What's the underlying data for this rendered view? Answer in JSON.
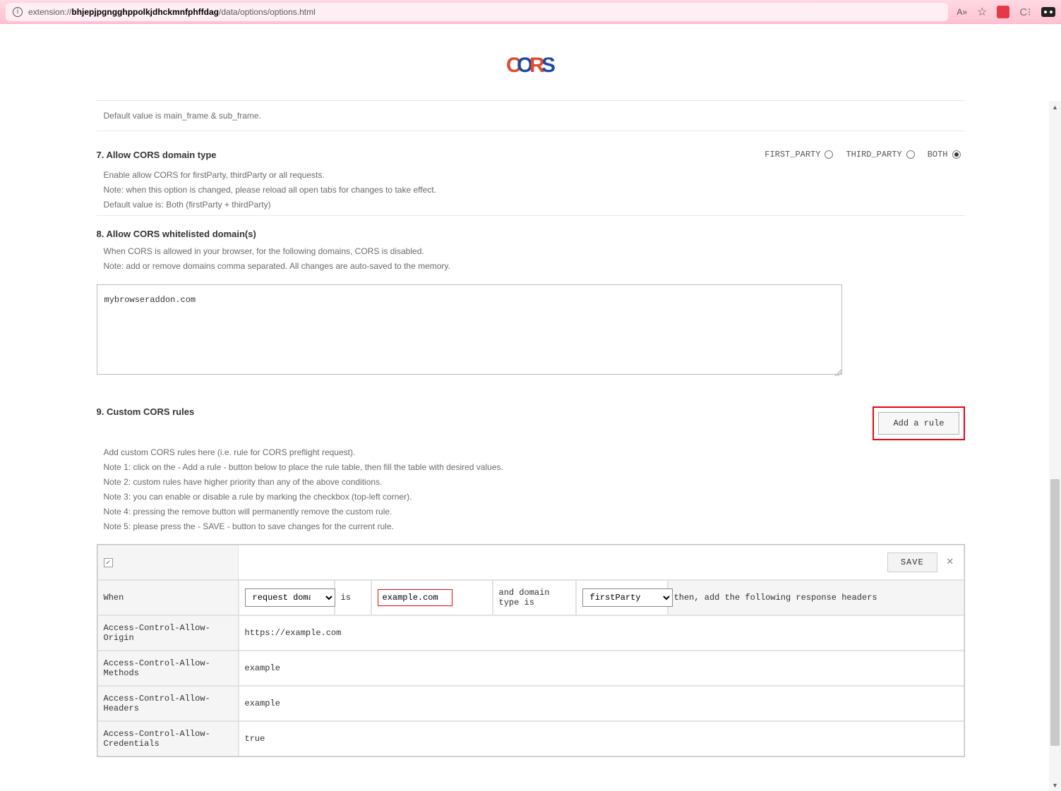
{
  "browser": {
    "url_prefix": "extension://",
    "url_bold": "bhjepjpgngghppolkjdhckmnfphffdag",
    "url_suffix": "/data/options/options.html",
    "reader_icon_label": "A»",
    "fav_icon_label": "☆"
  },
  "logo": {
    "letters": "CORS",
    "colors": {
      "C": "#e24a2b",
      "O": "#1e4aa0",
      "R": "#e24a2b",
      "S": "#1e4aa0"
    }
  },
  "prior_default": "Default value is main_frame & sub_frame.",
  "opt7": {
    "title": "7. Allow CORS domain type",
    "notes": [
      "Enable allow CORS for firstParty, thirdParty or all requests.",
      "Note: when this option is changed, please reload all open tabs for changes to take effect.",
      "Default value is: Both (firstParty + thirdParty)"
    ],
    "radios": [
      {
        "label": "FIRST_PARTY",
        "selected": false
      },
      {
        "label": "THIRD_PARTY",
        "selected": false
      },
      {
        "label": "BOTH",
        "selected": true
      }
    ]
  },
  "opt8": {
    "title": "8. Allow CORS whitelisted domain(s)",
    "notes": [
      "When CORS is allowed in your browser, for the following domains, CORS is disabled.",
      "Note: add or remove domains comma separated. All changes are auto-saved to the memory."
    ],
    "textarea_value": "mybrowseraddon.com"
  },
  "opt9": {
    "title": "9. Custom CORS rules",
    "add_button": "Add a rule",
    "notes": [
      "Add custom CORS rules here (i.e. rule for CORS preflight request).",
      "Note 1: click on the - Add a rule - button below to place the rule table, then fill the table with desired values.",
      "Note 2: custom rules have higher priority than any of the above conditions.",
      "Note 3: you can enable or disable a rule by marking the checkbox (top-left corner).",
      "Note 4: pressing the remove button will permanently remove the custom rule.",
      "Note 5: please press the - SAVE - button to save changes for the current rule."
    ],
    "rule": {
      "enabled": true,
      "save_label": "SAVE",
      "when_label": "When",
      "request_domain_label": "request domain",
      "is_label": "is",
      "domain_value": "example.com",
      "and_domain_type_label": "and domain type is",
      "domain_type_value": "firstParty",
      "then_label": "then, add the following response headers",
      "rows": [
        {
          "label": "Access-Control-Allow-Origin",
          "value": "https://example.com"
        },
        {
          "label": "Access-Control-Allow-Methods",
          "value": "example"
        },
        {
          "label": "Access-Control-Allow-Headers",
          "value": "example"
        },
        {
          "label": "Access-Control-Allow-Credentials",
          "value": "true"
        }
      ]
    }
  }
}
